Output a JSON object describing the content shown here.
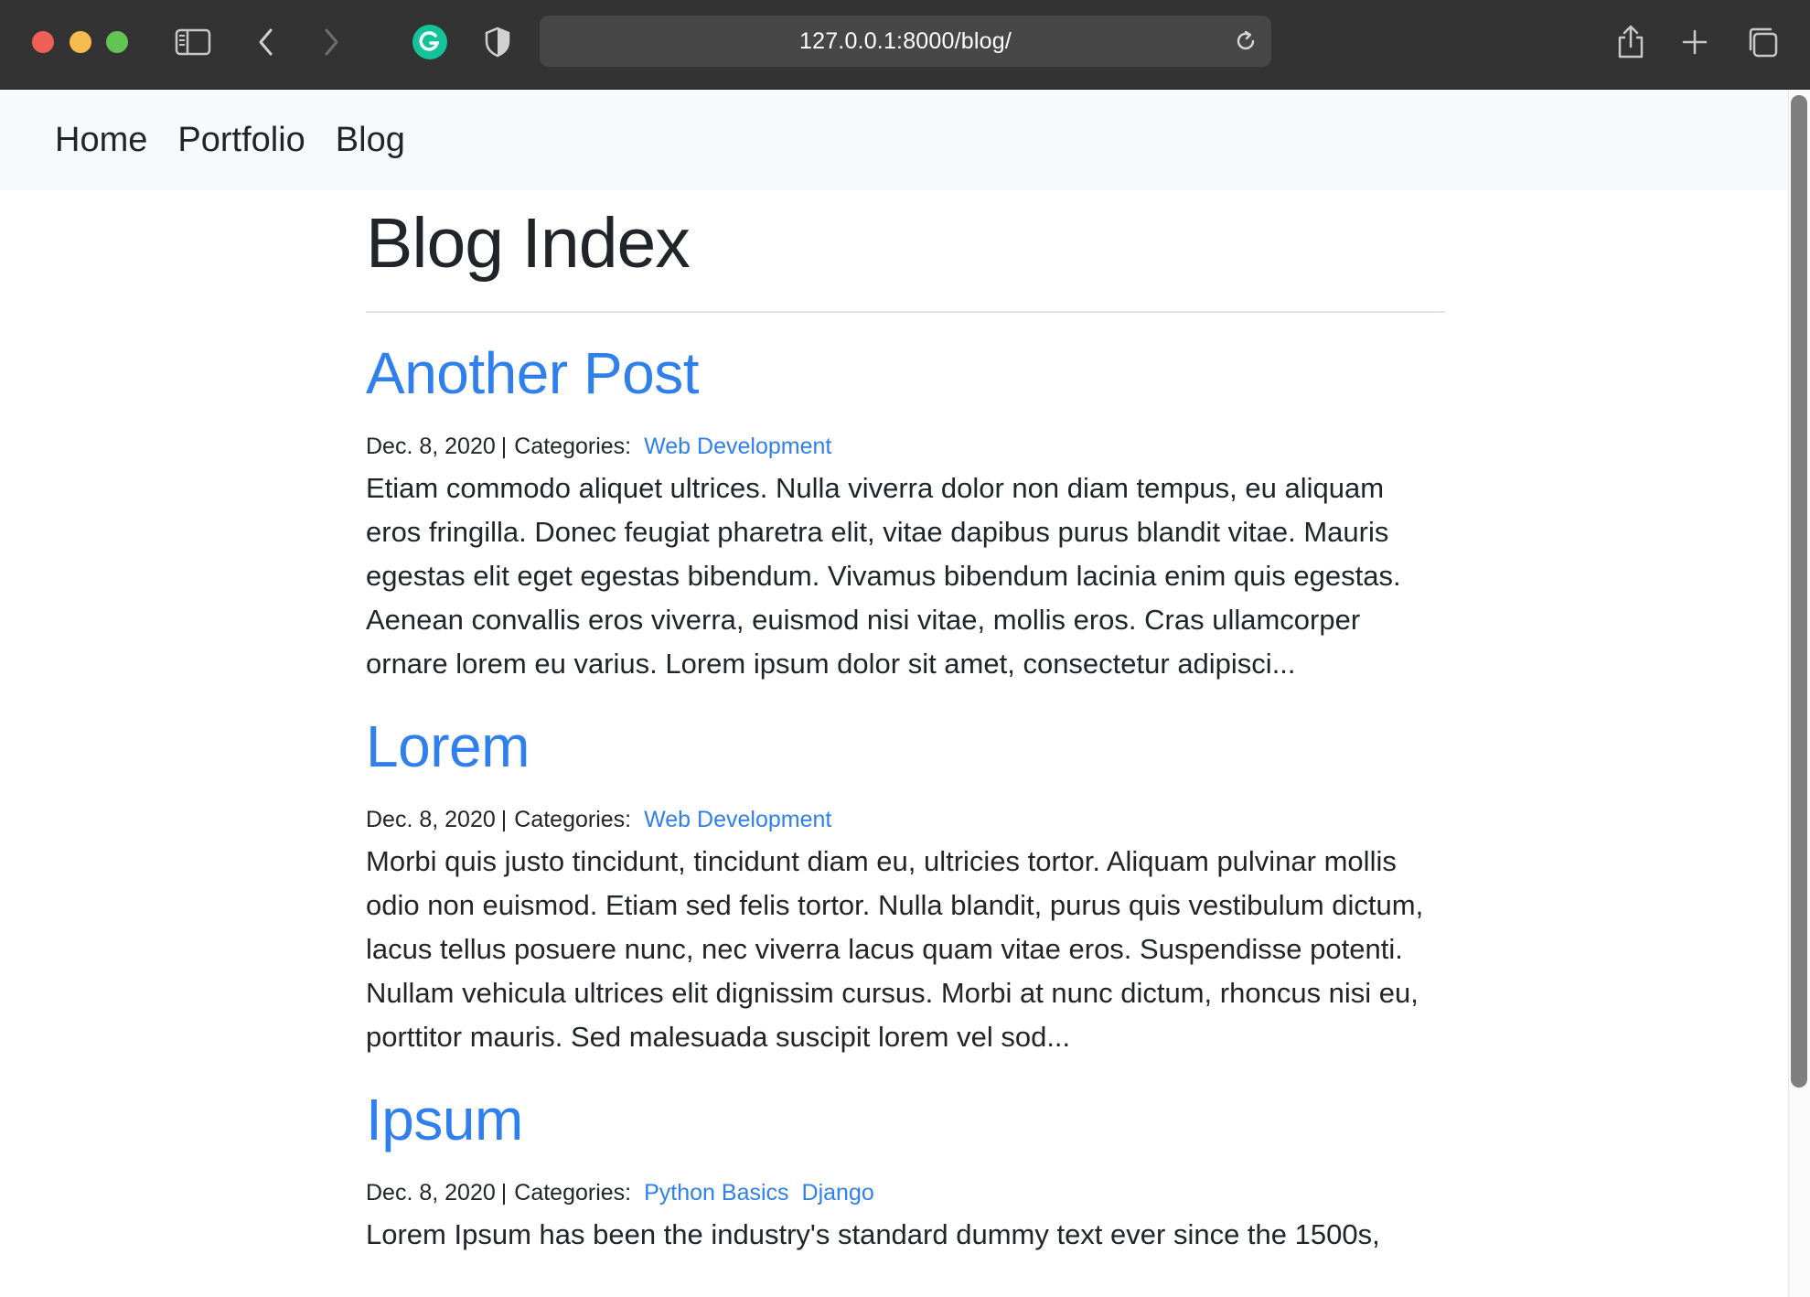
{
  "browser": {
    "url": "127.0.0.1:8000/blog/",
    "icons": {
      "sidebar": "sidebar-icon",
      "back": "chevron-left-icon",
      "forward": "chevron-right-icon",
      "grammarly": "grammarly-icon",
      "privacy": "shield-icon",
      "reload": "reload-icon",
      "share": "share-icon",
      "new_tab": "plus-icon",
      "tab_overview": "tabs-icon"
    },
    "colors": {
      "close": "#ee5f57",
      "minimize": "#f5bd4f",
      "zoom": "#61c454",
      "grammarly": "#15c39a"
    }
  },
  "navbar": {
    "items": [
      {
        "label": "Home"
      },
      {
        "label": "Portfolio"
      },
      {
        "label": "Blog"
      }
    ]
  },
  "page": {
    "title": "Blog Index",
    "link_color": "#2f80ed"
  },
  "posts": [
    {
      "title": "Another Post",
      "date": "Dec. 8, 2020",
      "separator": "|",
      "categories_label": "Categories:",
      "categories": [
        "Web Development"
      ],
      "excerpt": "Etiam commodo aliquet ultrices. Nulla viverra dolor non diam tempus, eu aliquam eros fringilla. Donec feugiat pharetra elit, vitae dapibus purus blandit vitae. Mauris egestas elit eget egestas bibendum. Vivamus bibendum lacinia enim quis egestas. Aenean convallis eros viverra, euismod nisi vitae, mollis eros. Cras ullamcorper ornare lorem eu varius. Lorem ipsum dolor sit amet, consectetur adipisci..."
    },
    {
      "title": "Lorem",
      "date": "Dec. 8, 2020",
      "separator": "|",
      "categories_label": "Categories:",
      "categories": [
        "Web Development"
      ],
      "excerpt": "Morbi quis justo tincidunt, tincidunt diam eu, ultricies tortor. Aliquam pulvinar mollis odio non euismod. Etiam sed felis tortor. Nulla blandit, purus quis vestibulum dictum, lacus tellus posuere nunc, nec viverra lacus quam vitae eros. Suspendisse potenti. Nullam vehicula ultrices elit dignissim cursus. Morbi at nunc dictum, rhoncus nisi eu, porttitor mauris. Sed malesuada suscipit lorem vel sod..."
    },
    {
      "title": "Ipsum",
      "date": "Dec. 8, 2020",
      "separator": "|",
      "categories_label": "Categories:",
      "categories": [
        "Python Basics",
        "Django"
      ],
      "excerpt": "Lorem Ipsum has been the industry's standard dummy text ever since the 1500s,"
    }
  ]
}
